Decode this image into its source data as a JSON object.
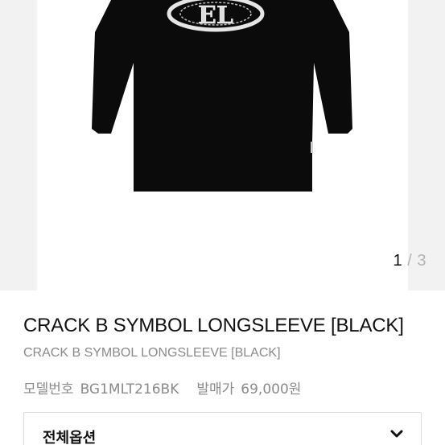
{
  "gallery": {
    "image_label": "EL",
    "pager": {
      "current": "1",
      "separator": "/",
      "total": "3"
    }
  },
  "product": {
    "title": "CRACK B SYMBOL LONGSLEEVE [BLACK]",
    "subtitle": "CRACK B SYMBOL LONGSLEEVE [BLACK]",
    "model_label": "모델번호",
    "model_value": "BG1MLT216BK",
    "price_label": "발매가",
    "price_value": "69,000원"
  },
  "options": {
    "label": "전체옵션",
    "icon": "chevron-down-icon"
  },
  "colors": {
    "shirt": "#0b0b0b",
    "gallery_bg": "#f2f2f2"
  }
}
